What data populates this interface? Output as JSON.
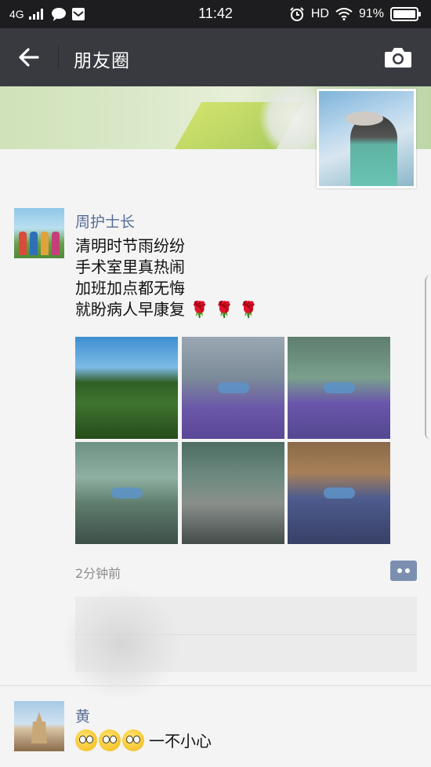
{
  "status_bar": {
    "network": "4G",
    "time": "11:42",
    "hd": "HD",
    "battery": "91%"
  },
  "nav": {
    "title": "朋友圈"
  },
  "post": {
    "author": "周护士长",
    "lines": [
      "清明时节雨纷纷",
      "手术室里真热闹",
      "加班加点都无悔",
      "就盼病人早康复"
    ],
    "roses": "🌹 🌹 🌹",
    "time": "2分钟前",
    "photo_count": 6
  },
  "post2": {
    "author": "黄",
    "text": "一不小心"
  },
  "colors": {
    "nav_bg": "#393a3f",
    "link": "#576b95",
    "time_gray": "#8d8d8d"
  },
  "icons": [
    "signal-icon",
    "chat-icon",
    "mail-icon",
    "alarm-icon",
    "wifi-icon",
    "battery-icon",
    "back-arrow-icon",
    "camera-icon",
    "comment-icon"
  ]
}
